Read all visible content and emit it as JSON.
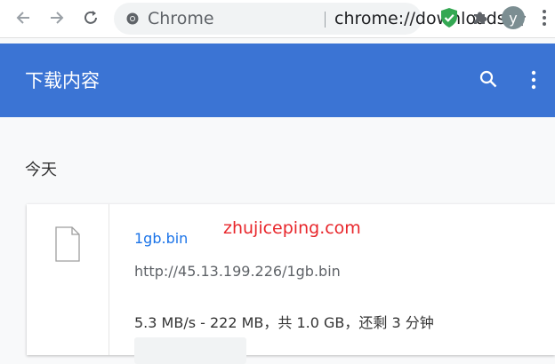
{
  "browser": {
    "omnibox": {
      "label": "Chrome",
      "url": "chrome://downloads"
    },
    "avatar_letter": "y"
  },
  "header": {
    "title": "下载内容"
  },
  "section": {
    "date": "今天"
  },
  "download": {
    "file_name": "1gb.bin",
    "url": "http://45.13.199.226/1gb.bin",
    "progress": "5.3 MB/s - 222 MB，共 1.0 GB，还剩 3 分钟"
  },
  "watermark": "zhujiceping.com",
  "colors": {
    "app_bar": "#3b74d4",
    "link": "#1a73e8",
    "watermark": "#e8262b"
  }
}
